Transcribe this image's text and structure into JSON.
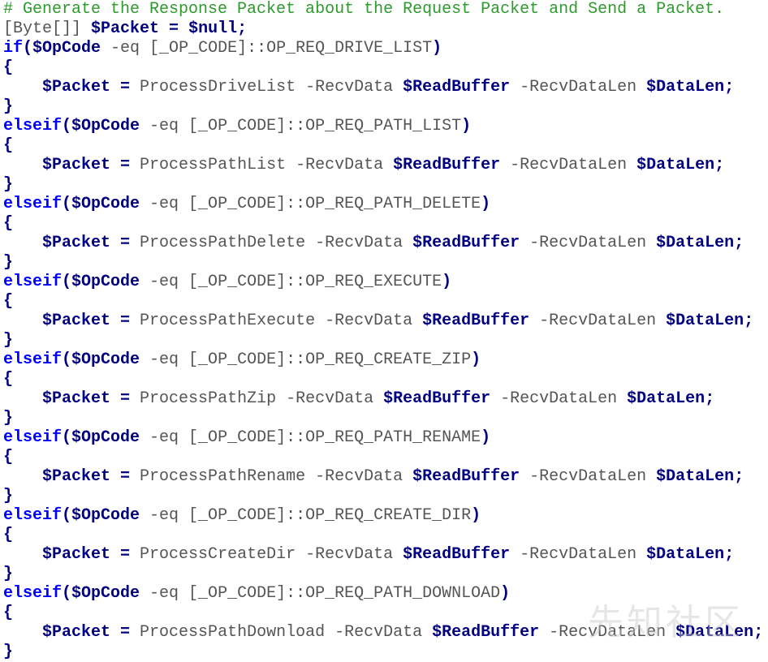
{
  "editor": {
    "lines": [
      [
        {
          "t": "comment",
          "v": "# Generate the Response Packet about the Request Packet and Send a Packet."
        }
      ],
      [
        {
          "t": "type",
          "v": "[Byte[]] "
        },
        {
          "t": "var",
          "v": "$Packet"
        },
        {
          "t": "op",
          "v": " = "
        },
        {
          "t": "var",
          "v": "$null"
        },
        {
          "t": "punct",
          "v": ";"
        }
      ],
      [
        {
          "t": "kw",
          "v": "if"
        },
        {
          "t": "punct",
          "v": "("
        },
        {
          "t": "var",
          "v": "$OpCode"
        },
        {
          "t": "plain",
          "v": " -eq [_OP_CODE]::OP_REQ_DRIVE_LIST"
        },
        {
          "t": "punct",
          "v": ")"
        }
      ],
      [
        {
          "t": "brace",
          "v": "{"
        }
      ],
      [
        {
          "t": "plain",
          "v": "    "
        },
        {
          "t": "var",
          "v": "$Packet"
        },
        {
          "t": "op",
          "v": " = "
        },
        {
          "t": "cmd",
          "v": "ProcessDriveList -RecvData "
        },
        {
          "t": "var",
          "v": "$ReadBuffer"
        },
        {
          "t": "param",
          "v": " -RecvDataLen "
        },
        {
          "t": "var",
          "v": "$DataLen"
        },
        {
          "t": "punct",
          "v": ";"
        }
      ],
      [
        {
          "t": "brace",
          "v": "}"
        }
      ],
      [
        {
          "t": "kw",
          "v": "elseif"
        },
        {
          "t": "punct",
          "v": "("
        },
        {
          "t": "var",
          "v": "$OpCode"
        },
        {
          "t": "plain",
          "v": " -eq [_OP_CODE]::OP_REQ_PATH_LIST"
        },
        {
          "t": "punct",
          "v": ")"
        }
      ],
      [
        {
          "t": "brace",
          "v": "{"
        }
      ],
      [
        {
          "t": "plain",
          "v": "    "
        },
        {
          "t": "var",
          "v": "$Packet"
        },
        {
          "t": "op",
          "v": " = "
        },
        {
          "t": "cmd",
          "v": "ProcessPathList -RecvData "
        },
        {
          "t": "var",
          "v": "$ReadBuffer"
        },
        {
          "t": "param",
          "v": " -RecvDataLen "
        },
        {
          "t": "var",
          "v": "$DataLen"
        },
        {
          "t": "punct",
          "v": ";"
        }
      ],
      [
        {
          "t": "brace",
          "v": "}"
        }
      ],
      [
        {
          "t": "kw",
          "v": "elseif"
        },
        {
          "t": "punct",
          "v": "("
        },
        {
          "t": "var",
          "v": "$OpCode"
        },
        {
          "t": "plain",
          "v": " -eq [_OP_CODE]::OP_REQ_PATH_DELETE"
        },
        {
          "t": "punct",
          "v": ")"
        }
      ],
      [
        {
          "t": "brace",
          "v": "{"
        }
      ],
      [
        {
          "t": "plain",
          "v": "    "
        },
        {
          "t": "var",
          "v": "$Packet"
        },
        {
          "t": "op",
          "v": " = "
        },
        {
          "t": "cmd",
          "v": "ProcessPathDelete -RecvData "
        },
        {
          "t": "var",
          "v": "$ReadBuffer"
        },
        {
          "t": "param",
          "v": " -RecvDataLen "
        },
        {
          "t": "var",
          "v": "$DataLen"
        },
        {
          "t": "punct",
          "v": ";"
        }
      ],
      [
        {
          "t": "brace",
          "v": "}"
        }
      ],
      [
        {
          "t": "kw",
          "v": "elseif"
        },
        {
          "t": "punct",
          "v": "("
        },
        {
          "t": "var",
          "v": "$OpCode"
        },
        {
          "t": "plain",
          "v": " -eq [_OP_CODE]::OP_REQ_EXECUTE"
        },
        {
          "t": "punct",
          "v": ")"
        }
      ],
      [
        {
          "t": "brace",
          "v": "{"
        }
      ],
      [
        {
          "t": "plain",
          "v": "    "
        },
        {
          "t": "var",
          "v": "$Packet"
        },
        {
          "t": "op",
          "v": " = "
        },
        {
          "t": "cmd",
          "v": "ProcessPathExecute -RecvData "
        },
        {
          "t": "var",
          "v": "$ReadBuffer"
        },
        {
          "t": "param",
          "v": " -RecvDataLen "
        },
        {
          "t": "var",
          "v": "$DataLen"
        },
        {
          "t": "punct",
          "v": ";"
        }
      ],
      [
        {
          "t": "brace",
          "v": "}"
        }
      ],
      [
        {
          "t": "kw",
          "v": "elseif"
        },
        {
          "t": "punct",
          "v": "("
        },
        {
          "t": "var",
          "v": "$OpCode"
        },
        {
          "t": "plain",
          "v": " -eq [_OP_CODE]::OP_REQ_CREATE_ZIP"
        },
        {
          "t": "punct",
          "v": ")"
        }
      ],
      [
        {
          "t": "brace",
          "v": "{"
        }
      ],
      [
        {
          "t": "plain",
          "v": "    "
        },
        {
          "t": "var",
          "v": "$Packet"
        },
        {
          "t": "op",
          "v": " = "
        },
        {
          "t": "cmd",
          "v": "ProcessPathZip -RecvData "
        },
        {
          "t": "var",
          "v": "$ReadBuffer"
        },
        {
          "t": "param",
          "v": " -RecvDataLen "
        },
        {
          "t": "var",
          "v": "$DataLen"
        },
        {
          "t": "punct",
          "v": ";"
        }
      ],
      [
        {
          "t": "brace",
          "v": "}"
        }
      ],
      [
        {
          "t": "kw",
          "v": "elseif"
        },
        {
          "t": "punct",
          "v": "("
        },
        {
          "t": "var",
          "v": "$OpCode"
        },
        {
          "t": "plain",
          "v": " -eq [_OP_CODE]::OP_REQ_PATH_RENAME"
        },
        {
          "t": "punct",
          "v": ")"
        }
      ],
      [
        {
          "t": "brace",
          "v": "{"
        }
      ],
      [
        {
          "t": "plain",
          "v": "    "
        },
        {
          "t": "var",
          "v": "$Packet"
        },
        {
          "t": "op",
          "v": " = "
        },
        {
          "t": "cmd",
          "v": "ProcessPathRename -RecvData "
        },
        {
          "t": "var",
          "v": "$ReadBuffer"
        },
        {
          "t": "param",
          "v": " -RecvDataLen "
        },
        {
          "t": "var",
          "v": "$DataLen"
        },
        {
          "t": "punct",
          "v": ";"
        }
      ],
      [
        {
          "t": "brace",
          "v": "}"
        }
      ],
      [
        {
          "t": "kw",
          "v": "elseif"
        },
        {
          "t": "punct",
          "v": "("
        },
        {
          "t": "var",
          "v": "$OpCode"
        },
        {
          "t": "plain",
          "v": " -eq [_OP_CODE]::OP_REQ_CREATE_DIR"
        },
        {
          "t": "punct",
          "v": ")"
        }
      ],
      [
        {
          "t": "brace",
          "v": "{"
        }
      ],
      [
        {
          "t": "plain",
          "v": "    "
        },
        {
          "t": "var",
          "v": "$Packet"
        },
        {
          "t": "op",
          "v": " = "
        },
        {
          "t": "cmd",
          "v": "ProcessCreateDir -RecvData "
        },
        {
          "t": "var",
          "v": "$ReadBuffer"
        },
        {
          "t": "param",
          "v": " -RecvDataLen "
        },
        {
          "t": "var",
          "v": "$DataLen"
        },
        {
          "t": "punct",
          "v": ";"
        }
      ],
      [
        {
          "t": "brace",
          "v": "}"
        }
      ],
      [
        {
          "t": "kw",
          "v": "elseif"
        },
        {
          "t": "punct",
          "v": "("
        },
        {
          "t": "var",
          "v": "$OpCode"
        },
        {
          "t": "plain",
          "v": " -eq [_OP_CODE]::OP_REQ_PATH_DOWNLOAD"
        },
        {
          "t": "punct",
          "v": ")"
        }
      ],
      [
        {
          "t": "brace",
          "v": "{"
        }
      ],
      [
        {
          "t": "plain",
          "v": "    "
        },
        {
          "t": "var",
          "v": "$Packet"
        },
        {
          "t": "op",
          "v": " = "
        },
        {
          "t": "cmd",
          "v": "ProcessPathDownload -RecvData "
        },
        {
          "t": "var",
          "v": "$ReadBuffer"
        },
        {
          "t": "param",
          "v": " -RecvDataLen "
        },
        {
          "t": "var",
          "v": "$DataLen"
        },
        {
          "t": "punct",
          "v": ";"
        }
      ],
      [
        {
          "t": "brace",
          "v": "}"
        }
      ]
    ]
  },
  "watermark": {
    "text": "先知社区"
  },
  "colors": {
    "comment": "#2e9a2e",
    "keyword": "#0000ff",
    "variable": "#000080",
    "plain": "#555555",
    "background": "#ffffff"
  }
}
